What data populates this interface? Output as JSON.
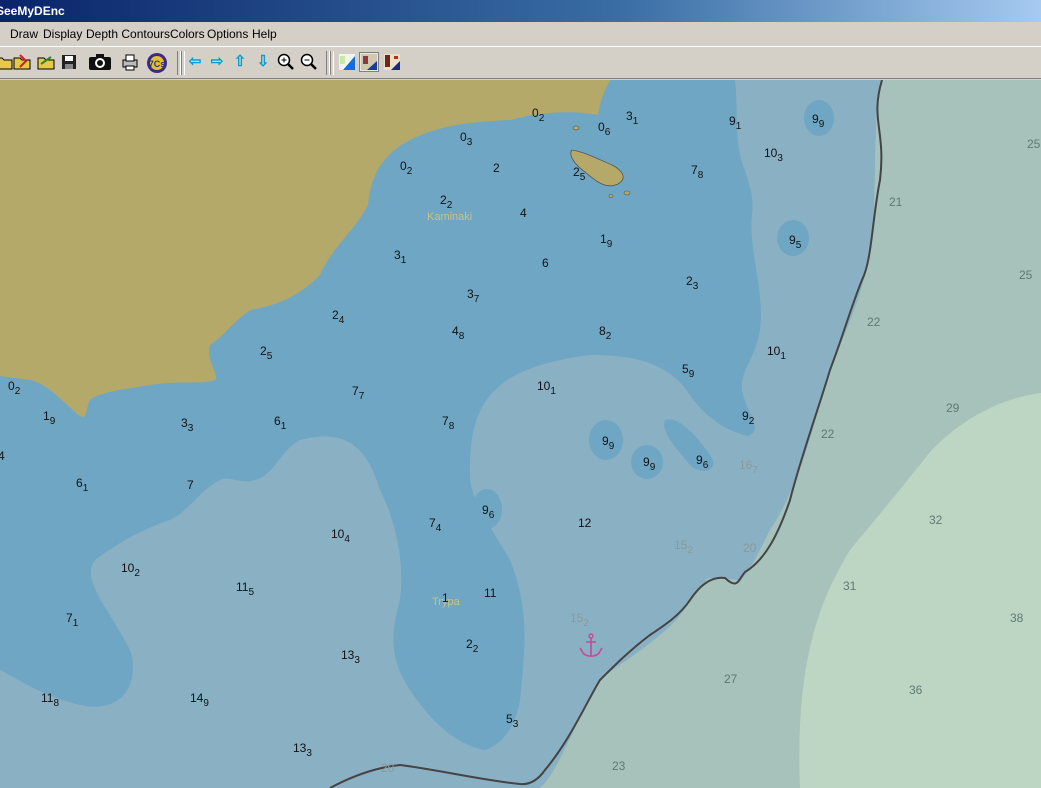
{
  "window": {
    "title": "SeeMyDEnc"
  },
  "menu": [
    "Draw",
    "Display",
    "Depth Contours",
    "Colors",
    "Options",
    "Help"
  ],
  "toolbar": {
    "icons": [
      "open-icon",
      "open-red-icon",
      "open-folder-icon",
      "save-icon",
      "camera-icon",
      "print-icon",
      "7cs-icon",
      "pan-left-icon",
      "pan-right-icon",
      "pan-up-icon",
      "pan-down-icon",
      "zoom-in-icon",
      "zoom-out-icon",
      "day-mode-icon",
      "dusk-mode-icon",
      "night-mode-icon"
    ]
  },
  "map": {
    "colors": {
      "land": "#b5a96a",
      "shallow": "#6fa6c3",
      "medium": "#8ab0c4",
      "deep": "#a6c2bb",
      "deepest": "#bdd6c3",
      "coast": "#444444",
      "anchor": "#c8479a"
    },
    "place_names": [
      "Kaminaki",
      "Trypa"
    ],
    "soundings": [
      {
        "m": "0",
        "s": "2"
      },
      {
        "m": "0",
        "s": "3"
      },
      {
        "m": "0",
        "s": "6"
      },
      {
        "m": "3",
        "s": "1"
      },
      {
        "m": "9",
        "s": "1"
      },
      {
        "m": "9",
        "s": "9"
      },
      {
        "m": "0",
        "s": "2"
      },
      {
        "m": "2",
        "s": ""
      },
      {
        "m": "2",
        "s": "5"
      },
      {
        "m": "7",
        "s": "8"
      },
      {
        "m": "10",
        "s": "3"
      },
      {
        "m": "2",
        "s": "2"
      },
      {
        "m": "4",
        "s": ""
      },
      {
        "m": "1",
        "s": "9"
      },
      {
        "m": "9",
        "s": "5"
      },
      {
        "m": "3",
        "s": "1"
      },
      {
        "m": "6",
        "s": ""
      },
      {
        "m": "3",
        "s": "7"
      },
      {
        "m": "2",
        "s": "3"
      },
      {
        "m": "2",
        "s": "4"
      },
      {
        "m": "4",
        "s": "8"
      },
      {
        "m": "8",
        "s": "2"
      },
      {
        "m": "2",
        "s": "5"
      },
      {
        "m": "10",
        "s": "1"
      },
      {
        "m": "0",
        "s": "2"
      },
      {
        "m": "7",
        "s": "7"
      },
      {
        "m": "10",
        "s": "1"
      },
      {
        "m": "5",
        "s": "9"
      },
      {
        "m": "1",
        "s": "9"
      },
      {
        "m": "3",
        "s": "3"
      },
      {
        "m": "6",
        "s": "1"
      },
      {
        "m": "7",
        "s": "8"
      },
      {
        "m": "9",
        "s": "2"
      },
      {
        "m": "9",
        "s": "9"
      },
      {
        "m": "9",
        "s": "9"
      },
      {
        "m": "9",
        "s": "6"
      },
      {
        "m": "16",
        "s": "7"
      },
      {
        "m": "4",
        "s": ""
      },
      {
        "m": "6",
        "s": "1"
      },
      {
        "m": "7",
        "s": ""
      },
      {
        "m": "9",
        "s": "6"
      },
      {
        "m": "12",
        "s": ""
      },
      {
        "m": "7",
        "s": "4"
      },
      {
        "m": "10",
        "s": "4"
      },
      {
        "m": "15",
        "s": "2"
      },
      {
        "m": "10",
        "s": "2"
      },
      {
        "m": "11",
        "s": "5"
      },
      {
        "m": "11",
        "s": ""
      },
      {
        "m": "7",
        "s": "1"
      },
      {
        "m": "15",
        "s": "2"
      },
      {
        "m": "2",
        "s": "2"
      },
      {
        "m": "13",
        "s": "3"
      },
      {
        "m": "11",
        "s": "8"
      },
      {
        "m": "14",
        "s": "9"
      },
      {
        "m": "5",
        "s": "3"
      },
      {
        "m": "13",
        "s": "3"
      },
      {
        "m": "1",
        "s": ""
      }
    ],
    "contour_labels": [
      "25",
      "21",
      "25",
      "22",
      "29",
      "22",
      "20",
      "32",
      "31",
      "38",
      "27",
      "36",
      "23",
      "20"
    ]
  }
}
